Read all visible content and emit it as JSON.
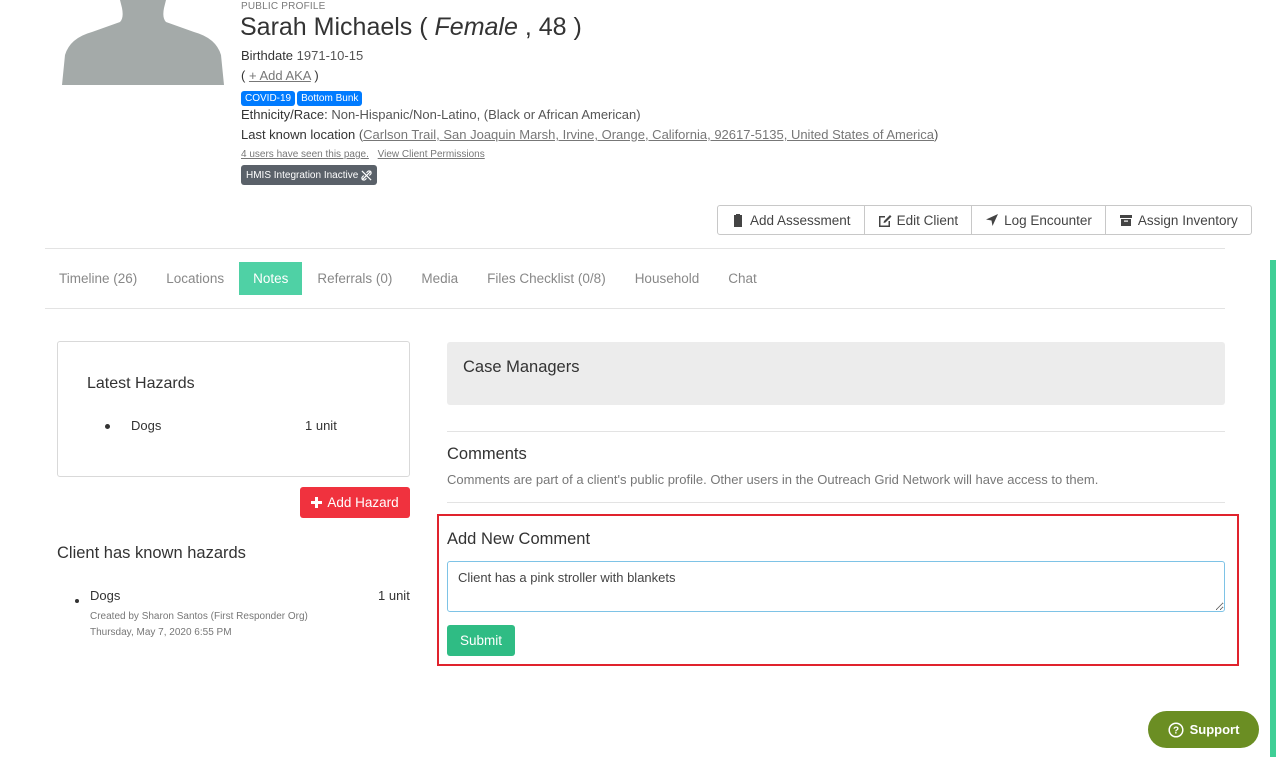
{
  "profile": {
    "public_label": "PUBLIC PROFILE",
    "name": "Sarah Michaels",
    "gender": "Female",
    "age": "48",
    "birthdate_label": "Birthdate",
    "birthdate": "1971-10-15",
    "add_aka": "+ Add AKA",
    "badges": [
      "COVID-19",
      "Bottom Bunk"
    ],
    "ethnicity_label": "Ethnicity/Race:",
    "ethnicity": "Non-Hispanic/Non-Latino, (Black or African American)",
    "location_label": "Last known location",
    "location": "Carlson Trail, San Joaquin Marsh, Irvine, Orange, California, 92617-5135, United States of America",
    "seen_text": "4 users have seen this page.",
    "permissions_link": "View Client Permissions",
    "hmis_label": "HMIS Integration Inactive"
  },
  "actions": [
    "Add Assessment",
    "Edit Client",
    "Log Encounter",
    "Assign Inventory"
  ],
  "tabs": [
    "Timeline (26)",
    "Locations",
    "Notes",
    "Referrals (0)",
    "Media",
    "Files Checklist (0/8)",
    "Household",
    "Chat"
  ],
  "active_tab": "Notes",
  "latest_hazards": {
    "title": "Latest Hazards",
    "items": [
      {
        "name": "Dogs",
        "qty": "1 unit"
      }
    ],
    "add_button": "Add Hazard"
  },
  "known_hazards": {
    "title": "Client has known hazards",
    "items": [
      {
        "name": "Dogs",
        "qty": "1 unit",
        "created_by": "Created by Sharon Santos (First Responder Org)",
        "date": "Thursday, May 7, 2020 6:55 PM"
      }
    ]
  },
  "case_managers": {
    "title": "Case Managers"
  },
  "comments": {
    "title": "Comments",
    "description": "Comments are part of a client's public profile. Other users in the Outreach Grid Network will have access to them.",
    "new_title": "Add New Comment",
    "input_value": "Client has a pink stroller with blankets",
    "submit": "Submit"
  },
  "support": {
    "label": "Support"
  },
  "colors": {
    "accent": "#4fd1a5",
    "danger": "#f0323e",
    "success": "#2fbc84",
    "badge": "#007bff",
    "support": "#6b8e23"
  }
}
